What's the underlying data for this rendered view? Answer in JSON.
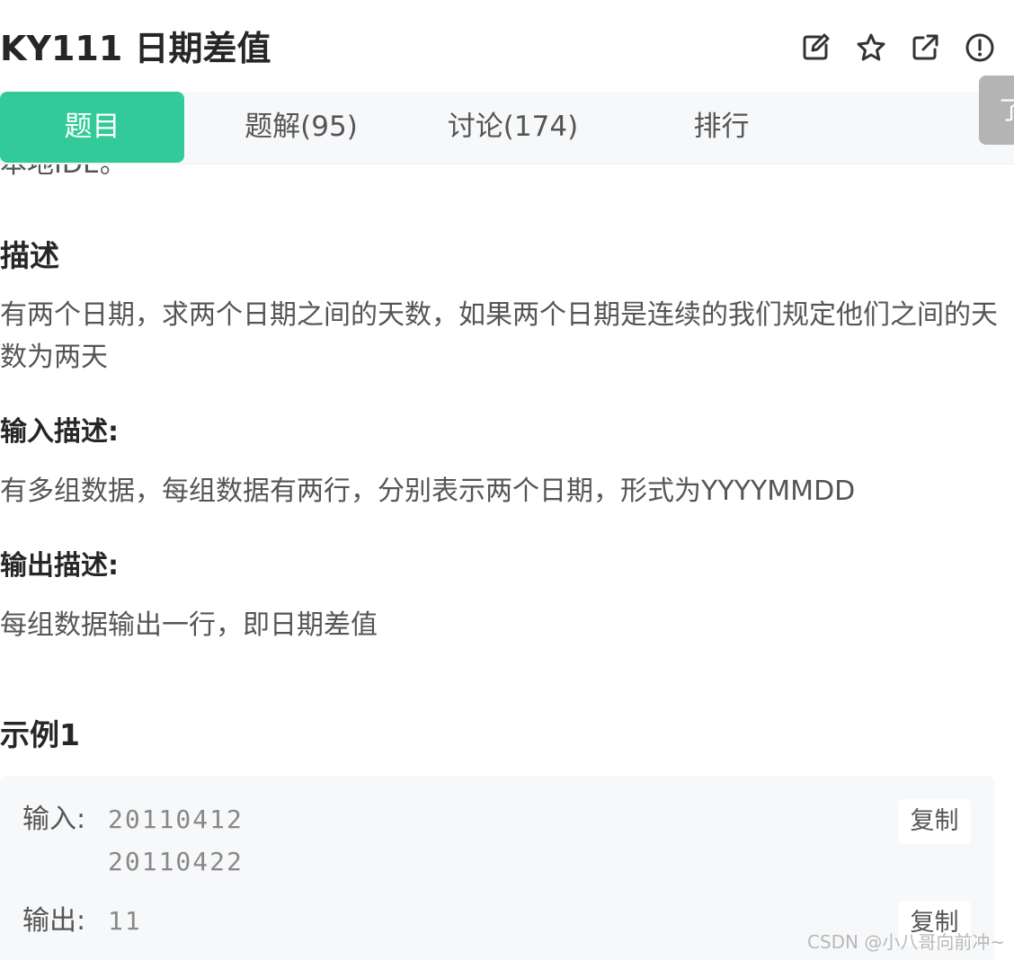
{
  "header": {
    "title": "KY111  日期差值",
    "icons": [
      "edit-icon",
      "star-icon",
      "external-link-icon",
      "report-icon"
    ]
  },
  "tabs": [
    {
      "label": "题目",
      "active": true
    },
    {
      "label": "题解(95)",
      "active": false
    },
    {
      "label": "讨论(174)",
      "active": false
    },
    {
      "label": "排行",
      "active": false
    }
  ],
  "side_tab": {
    "label": "了"
  },
  "content": {
    "cut_text": "本地IDE。",
    "description": {
      "heading": "描述",
      "text": "有两个日期，求两个日期之间的天数，如果两个日期是连续的我们规定他们之间的天数为两天"
    },
    "input_desc": {
      "heading": "输入描述:",
      "text": "有多组数据，每组数据有两行，分别表示两个日期，形式为YYYYMMDD"
    },
    "output_desc": {
      "heading": "输出描述:",
      "text": "每组数据输出一行，即日期差值"
    },
    "example": {
      "heading": "示例1",
      "input_label": "输入:",
      "input_lines": [
        "20110412",
        "20110422"
      ],
      "output_label": "输出:",
      "output_value": "11",
      "copy_label": "复制"
    }
  },
  "watermark": "CSDN @小八哥向前冲~",
  "colors": {
    "accent": "#32ca99",
    "tab_bar": "#f7f8fa",
    "side_tab": "#b4b4b4",
    "example_bg": "#f7f8fa"
  }
}
